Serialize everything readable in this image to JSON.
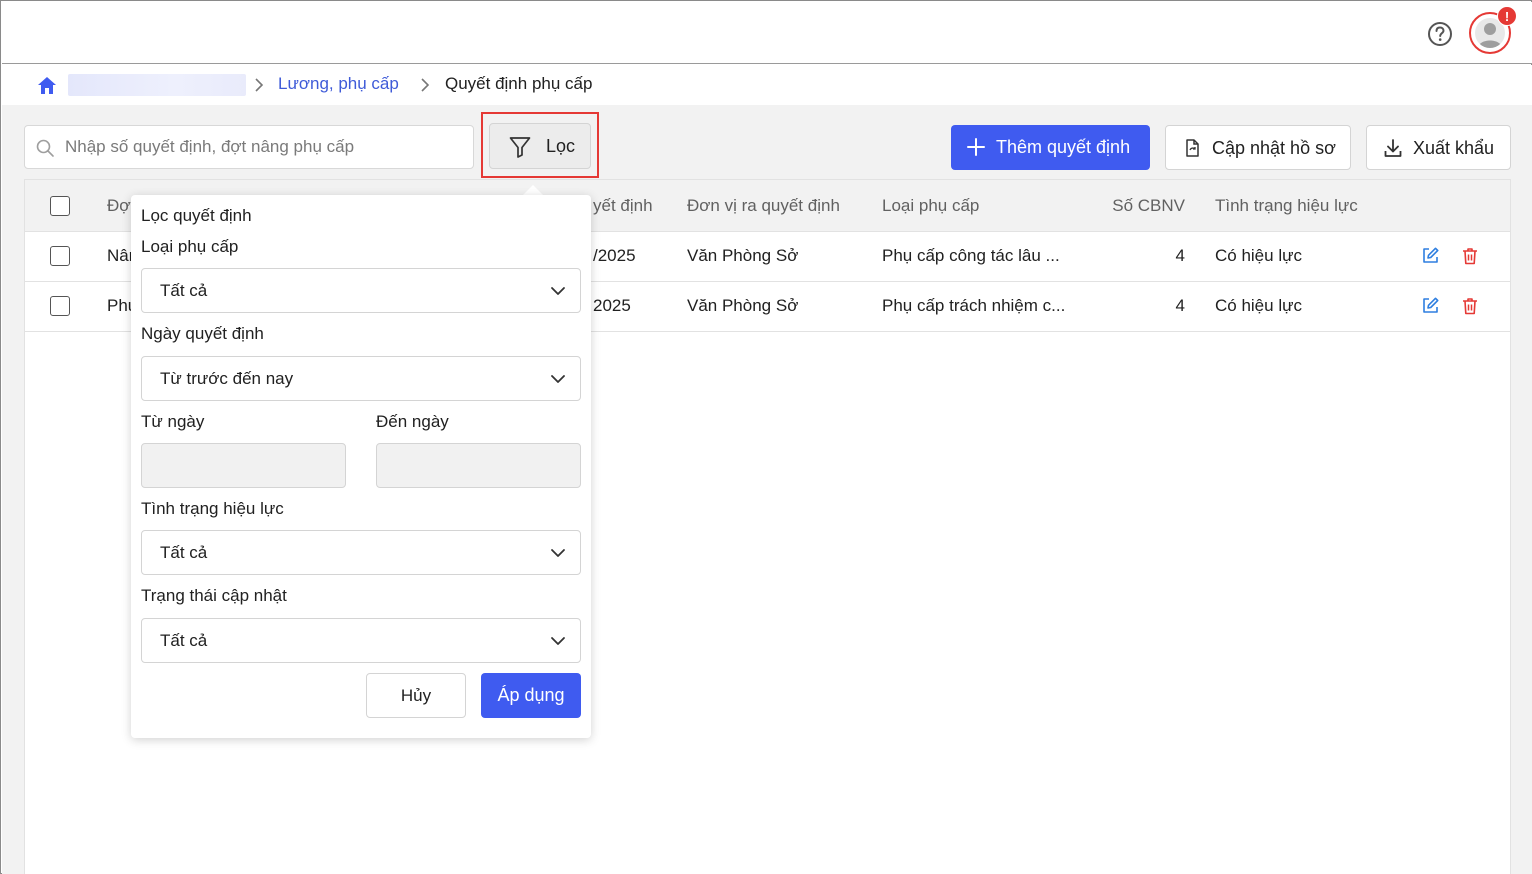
{
  "breadcrumb": {
    "link": "Lương, phụ cấp",
    "current": "Quyết định phụ cấp"
  },
  "notification_badge": "!",
  "toolbar": {
    "search_placeholder": "Nhập số quyết định, đợt nâng phụ cấp",
    "filter_label": "Lọc",
    "add_label": "Thêm quyết định",
    "update_label": "Cập nhật hồ sơ",
    "export_label": "Xuất khẩu"
  },
  "table": {
    "columns": {
      "batch": "Đợt",
      "date": "yết định",
      "unit": "Đơn vị ra quyết định",
      "type": "Loại phụ cấp",
      "count": "Số CBNV",
      "status": "Tình trạng hiệu lực"
    },
    "rows": [
      {
        "batch": "Nân",
        "date": "/2025",
        "unit": "Văn Phòng Sở",
        "type": "Phụ cấp công tác lâu ...",
        "count": "4",
        "status": "Có hiệu lực"
      },
      {
        "batch": "Phụ",
        "date": "2025",
        "unit": "Văn Phòng Sở",
        "type": "Phụ cấp trách nhiệm c...",
        "count": "4",
        "status": "Có hiệu lực"
      }
    ]
  },
  "filter_panel": {
    "title": "Lọc quyết định",
    "allowance_type_label": "Loại phụ cấp",
    "allowance_type_value": "Tất cả",
    "decision_date_label": "Ngày quyết định",
    "decision_date_value": "Từ trước đến nay",
    "from_date_label": "Từ ngày",
    "to_date_label": "Đến ngày",
    "validity_label": "Tình trạng hiệu lực",
    "validity_value": "Tất cả",
    "update_status_label": "Trạng thái cập nhật",
    "update_status_value": "Tất cả",
    "cancel_label": "Hủy",
    "apply_label": "Áp dụng"
  },
  "colors": {
    "primary": "#3f5bf0",
    "link": "#3f5bd8",
    "danger": "#e53935",
    "edit_icon": "#2f7fe0"
  }
}
